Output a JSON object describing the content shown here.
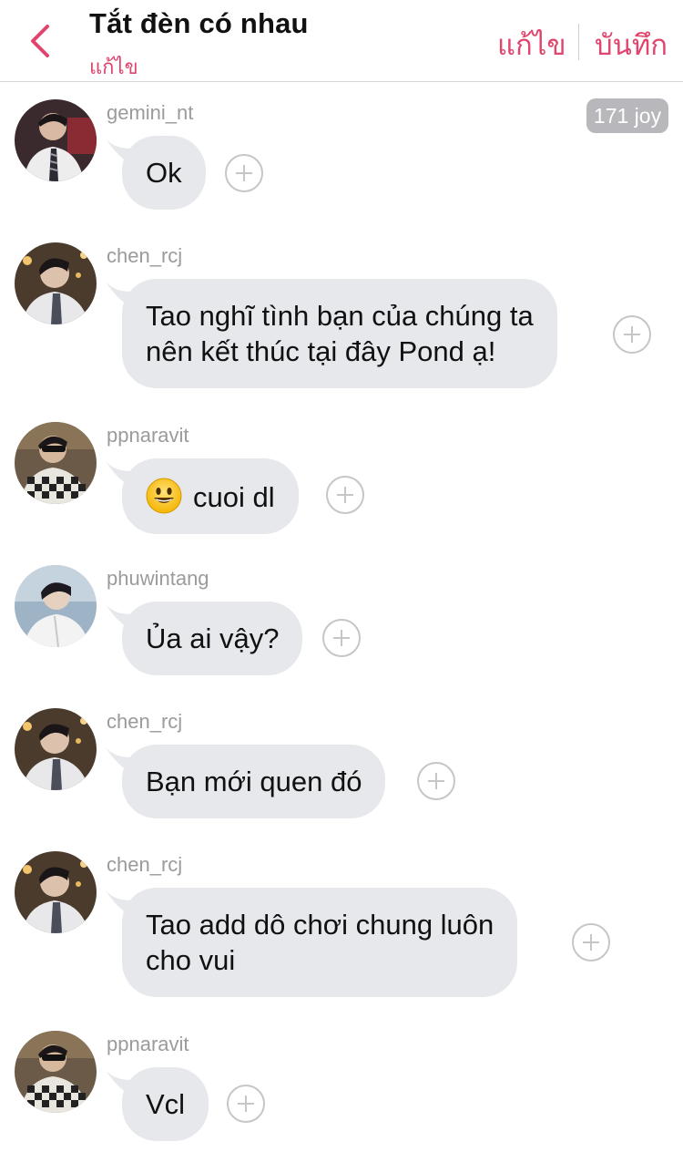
{
  "header": {
    "title": "Tắt đèn có nhau",
    "subtitle": "แก้ไข",
    "edit_label": "แก้ไข",
    "save_label": "บันทึก"
  },
  "badge": {
    "text": "171 joy"
  },
  "colors": {
    "accent": "#e0456d",
    "bubble": "#e6e8ec",
    "username": "#9b9b9b"
  },
  "messages": [
    {
      "username": "gemini_nt",
      "lines": [
        "Ok"
      ],
      "avatar": "avatar-gemini"
    },
    {
      "username": "chen_rcj",
      "lines": [
        "Tao nghĩ tình bạn của chúng ta",
        "nên kết thúc tại đây Pond ạ!"
      ],
      "avatar": "avatar-chen"
    },
    {
      "username": "ppnaravit",
      "lines": [
        "cuoi dl"
      ],
      "emoji": "smiley-emoji",
      "avatar": "avatar-pp"
    },
    {
      "username": "phuwintang",
      "lines": [
        "Ủa ai vậy?"
      ],
      "avatar": "avatar-phuwin"
    },
    {
      "username": "chen_rcj",
      "lines": [
        "Bạn mới quen đó"
      ],
      "avatar": "avatar-chen"
    },
    {
      "username": "chen_rcj",
      "lines": [
        "Tao add dô chơi chung luôn",
        "cho vui"
      ],
      "avatar": "avatar-chen"
    },
    {
      "username": "ppnaravit",
      "lines": [
        "Vcl"
      ],
      "avatar": "avatar-pp"
    }
  ],
  "icons": {
    "back": "chevron-left-icon",
    "react": "plus-circle-icon"
  }
}
